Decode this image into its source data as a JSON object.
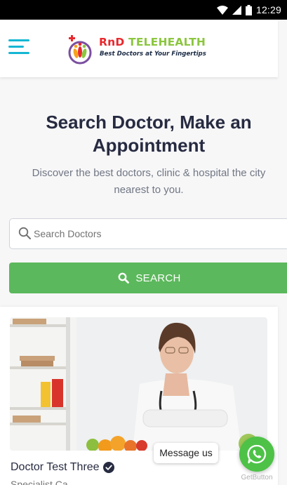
{
  "status_bar": {
    "time": "12:29"
  },
  "header": {
    "logo": {
      "brand_part1": "RnD",
      "brand_part2": "TELEHEALTH",
      "tagline": "Best Doctors at Your Fingertips"
    }
  },
  "hero": {
    "title": "Search Doctor, Make an Appointment",
    "subtitle": "Discover the best doctors, clinic & hospital the city nearest to you."
  },
  "search": {
    "placeholder": "Search Doctors",
    "value": "",
    "button_label": "SEARCH"
  },
  "doctor_card": {
    "name": "Doctor Test Three",
    "specialty": "Specialist Ca..."
  },
  "chat_widget": {
    "label": "Message us",
    "provider": "GetButton"
  },
  "colors": {
    "accent": "#15b7d3",
    "search_button": "#5cb85c",
    "whatsapp": "#4dc247",
    "brand_red": "#e8282d",
    "brand_green": "#8cc63f"
  }
}
